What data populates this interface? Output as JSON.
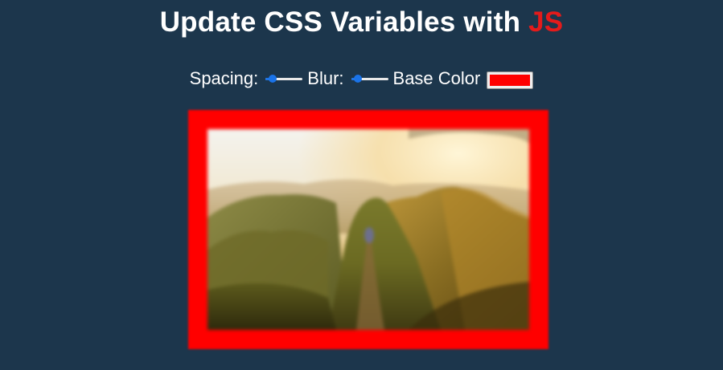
{
  "heading": {
    "prefix": "Update CSS Variables with ",
    "highlight": "JS",
    "highlight_color": "#e31b1b"
  },
  "controls": {
    "spacing": {
      "label": "Spacing:",
      "value_fraction": 0.1
    },
    "blur": {
      "label": "Blur:",
      "value_fraction": 0.1
    },
    "base_color": {
      "label": "Base Color",
      "value": "#ff0000"
    }
  },
  "image": {
    "icon": "mountain-landscape-photo",
    "frame_color": "#ff0000"
  }
}
